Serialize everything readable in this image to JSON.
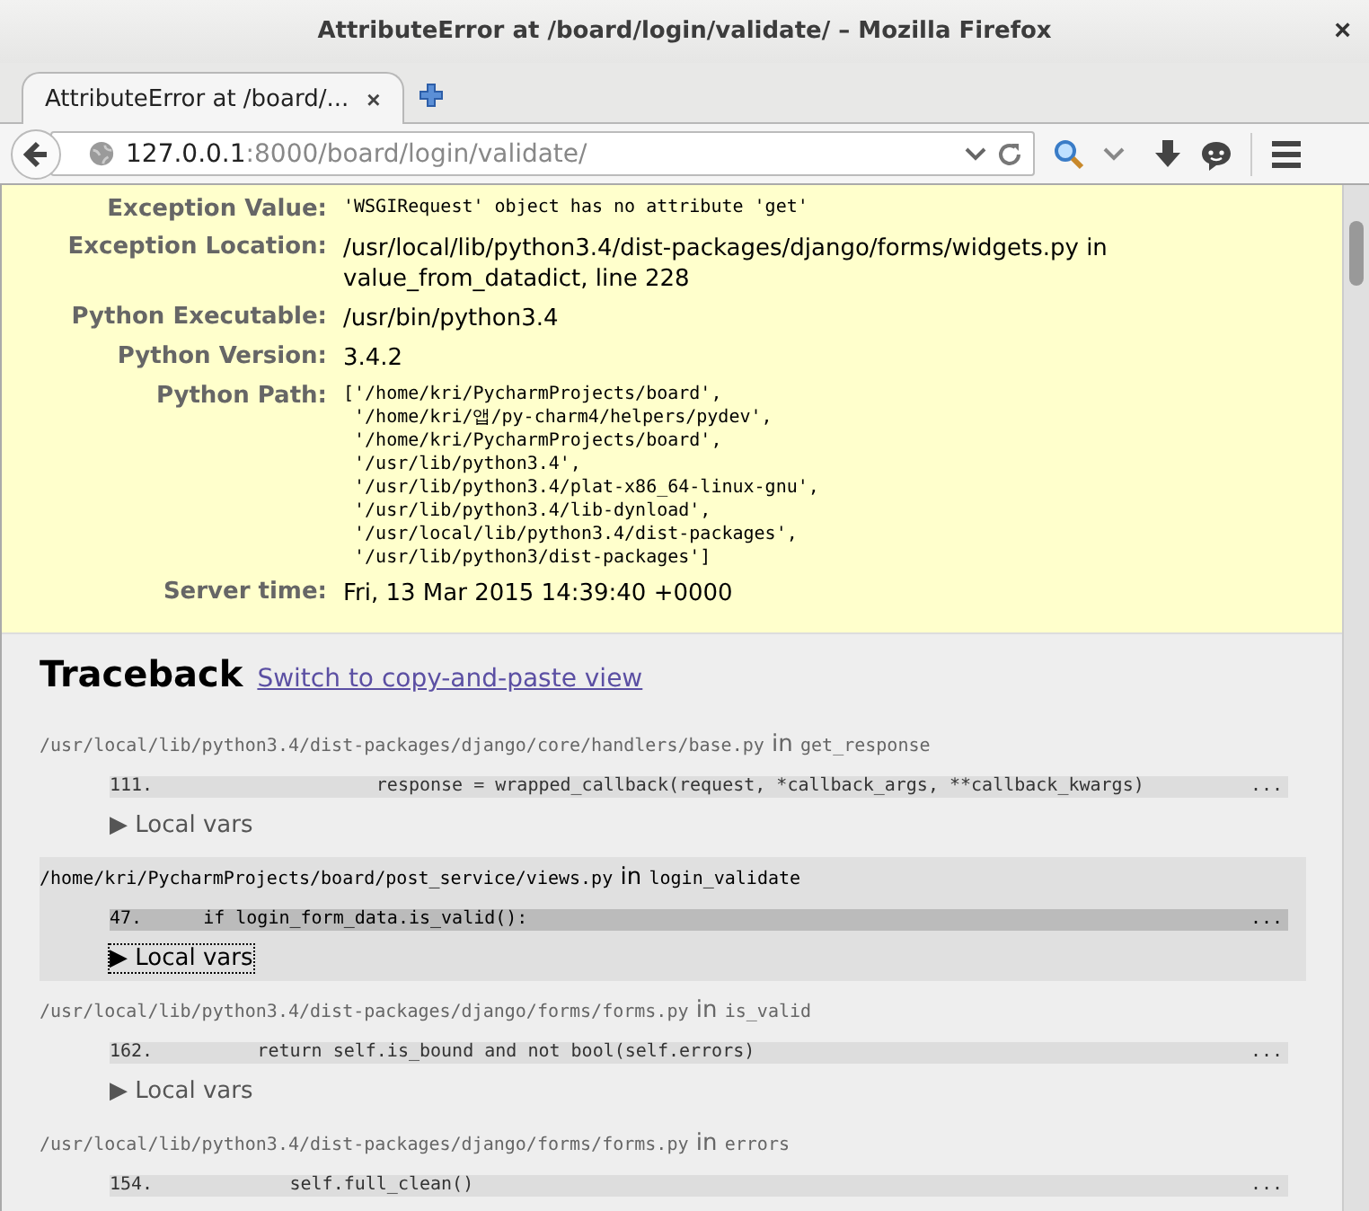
{
  "window": {
    "title": "AttributeError at /board/login/validate/ – Mozilla Firefox",
    "close": "×"
  },
  "tabs": [
    {
      "label": "AttributeError at /board/...",
      "selected": true,
      "close": "×"
    }
  ],
  "address_bar": {
    "host": "127.0.0.1",
    "rest": ":8000/board/login/validate/"
  },
  "summary": [
    {
      "label": "Exception Value:",
      "kind": "mono",
      "lines": [
        "'WSGIRequest' object has no attribute 'get'"
      ]
    },
    {
      "label": "Exception Location:",
      "kind": "text",
      "lines": [
        "/usr/local/lib/python3.4/dist-packages/django/forms/widgets.py in",
        "value_from_datadict, line 228"
      ]
    },
    {
      "label": "Python Executable:",
      "kind": "text",
      "lines": [
        "/usr/bin/python3.4"
      ]
    },
    {
      "label": "Python Version:",
      "kind": "text",
      "lines": [
        "3.4.2"
      ]
    },
    {
      "label": "Python Path:",
      "kind": "mono",
      "lines": [
        "['/home/kri/PycharmProjects/board',",
        " '/home/kri/앱/py-charm4/helpers/pydev',",
        " '/home/kri/PycharmProjects/board',",
        " '/usr/lib/python3.4',",
        " '/usr/lib/python3.4/plat-x86_64-linux-gnu',",
        " '/usr/lib/python3.4/lib-dynload',",
        " '/usr/local/lib/python3.4/dist-packages',",
        " '/usr/lib/python3/dist-packages']"
      ]
    },
    {
      "label": "Server time:",
      "kind": "text",
      "lines": [
        "Fri, 13 Mar 2015 14:39:40 +0000"
      ]
    }
  ],
  "traceback": {
    "title": "Traceback",
    "link": "Switch to copy-and-paste view",
    "frames": [
      {
        "file": "/usr/local/lib/python3.4/dist-packages/django/core/handlers/base.py",
        "in": "in",
        "function": "get_response",
        "line_no": "111.",
        "code": "                    response = wrapped_callback(request, *callback_args, **callback_kwargs)",
        "ellipsis": "...",
        "toggle": "▶ Local vars",
        "selected": false
      },
      {
        "file": "/home/kri/PycharmProjects/board/post_service/views.py",
        "in": "in",
        "function": "login_validate",
        "line_no": "47.",
        "code": "    if login_form_data.is_valid():",
        "ellipsis": "...",
        "toggle": "▶ Local vars",
        "selected": true
      },
      {
        "file": "/usr/local/lib/python3.4/dist-packages/django/forms/forms.py",
        "in": "in",
        "function": "is_valid",
        "line_no": "162.",
        "code": "         return self.is_bound and not bool(self.errors)",
        "ellipsis": "...",
        "toggle": "▶ Local vars",
        "selected": false
      },
      {
        "file": "/usr/local/lib/python3.4/dist-packages/django/forms/forms.py",
        "in": "in",
        "function": "errors",
        "line_no": "154.",
        "code": "            self.full_clean()",
        "ellipsis": "...",
        "selected": false
      }
    ]
  }
}
